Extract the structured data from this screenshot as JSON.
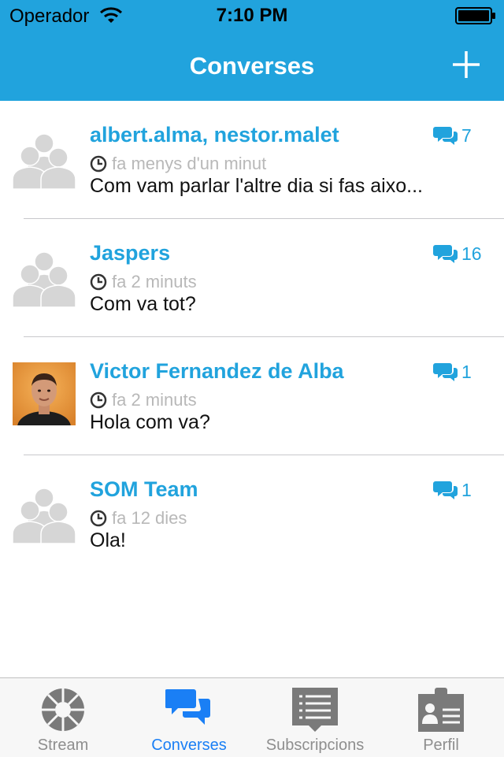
{
  "status_bar": {
    "carrier": "Operador",
    "time": "7:10 PM"
  },
  "nav": {
    "title": "Converses"
  },
  "conversations": [
    {
      "name": "albert.alma, nestor.malet",
      "count": "7",
      "time": "fa menys d'un minut",
      "message": "Com vam parlar l'altre dia si fas aixo..."
    },
    {
      "name": "Jaspers",
      "count": "16",
      "time": "fa 2 minuts",
      "message": "Com va tot?"
    },
    {
      "name": "Victor Fernandez de Alba",
      "count": "1",
      "time": "fa 2 minuts",
      "message": "Hola com va?"
    },
    {
      "name": "SOM Team",
      "count": "1",
      "time": "fa 12 dies",
      "message": "Ola!"
    }
  ],
  "tabs": [
    {
      "label": "Stream",
      "icon": "stream-icon"
    },
    {
      "label": "Converses",
      "icon": "chat-bubbles-icon"
    },
    {
      "label": "Subscripcions",
      "icon": "subscriptions-icon"
    },
    {
      "label": "Perfil",
      "icon": "profile-card-icon"
    }
  ],
  "colors": {
    "brand": "#21a3dd",
    "tab_active": "#1a7ff5",
    "tab_inactive": "#8e8e8e",
    "muted": "#b8b8b8"
  }
}
